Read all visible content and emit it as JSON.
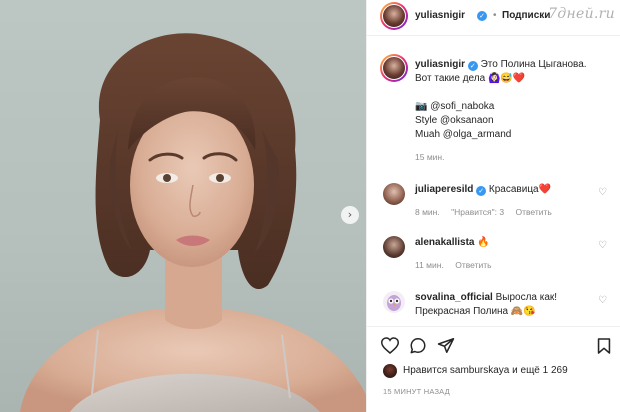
{
  "watermark": "7дней.ru",
  "post": {
    "author": "yuliasnigir",
    "separator": "•",
    "follow_label": "Подписки"
  },
  "caption": {
    "author": "yuliasnigir",
    "line1": "Это Полина Цыганова.",
    "line2": "Вот такие дела 🙆🏻‍♀️😅❤️",
    "photo_credit": "📷 @sofi_naboka",
    "style_credit": "Style @oksanaon",
    "muah_credit": "Muah @olga_armand",
    "time": "15 мин."
  },
  "comments": [
    {
      "user": "juliaperesild",
      "verified": true,
      "text": "Красавица❤️",
      "time": "8 мин.",
      "likes": "\"Нравится\": 3",
      "reply": "Ответить"
    },
    {
      "user": "alenakallista",
      "verified": false,
      "text": "🔥",
      "time": "11 мин.",
      "likes": "",
      "reply": "Ответить"
    },
    {
      "user": "sovalina_official",
      "verified": false,
      "text": "Выросла как!",
      "text2": "Прекрасная Полина 🙈😘",
      "time": "",
      "likes": "",
      "reply": ""
    }
  ],
  "icons": {
    "like": "heart-icon",
    "comment": "comment-icon",
    "share": "paper-plane-icon",
    "save": "bookmark-icon",
    "next": "chevron-right-icon"
  },
  "likes_summary": "Нравится samburskaya и ещё 1 269",
  "posted_ago": "15 МИНУТ НАЗАД",
  "colors": {
    "verified": "#3897f0",
    "heart": "#ed4956",
    "meta_text": "#8e8e8e"
  }
}
